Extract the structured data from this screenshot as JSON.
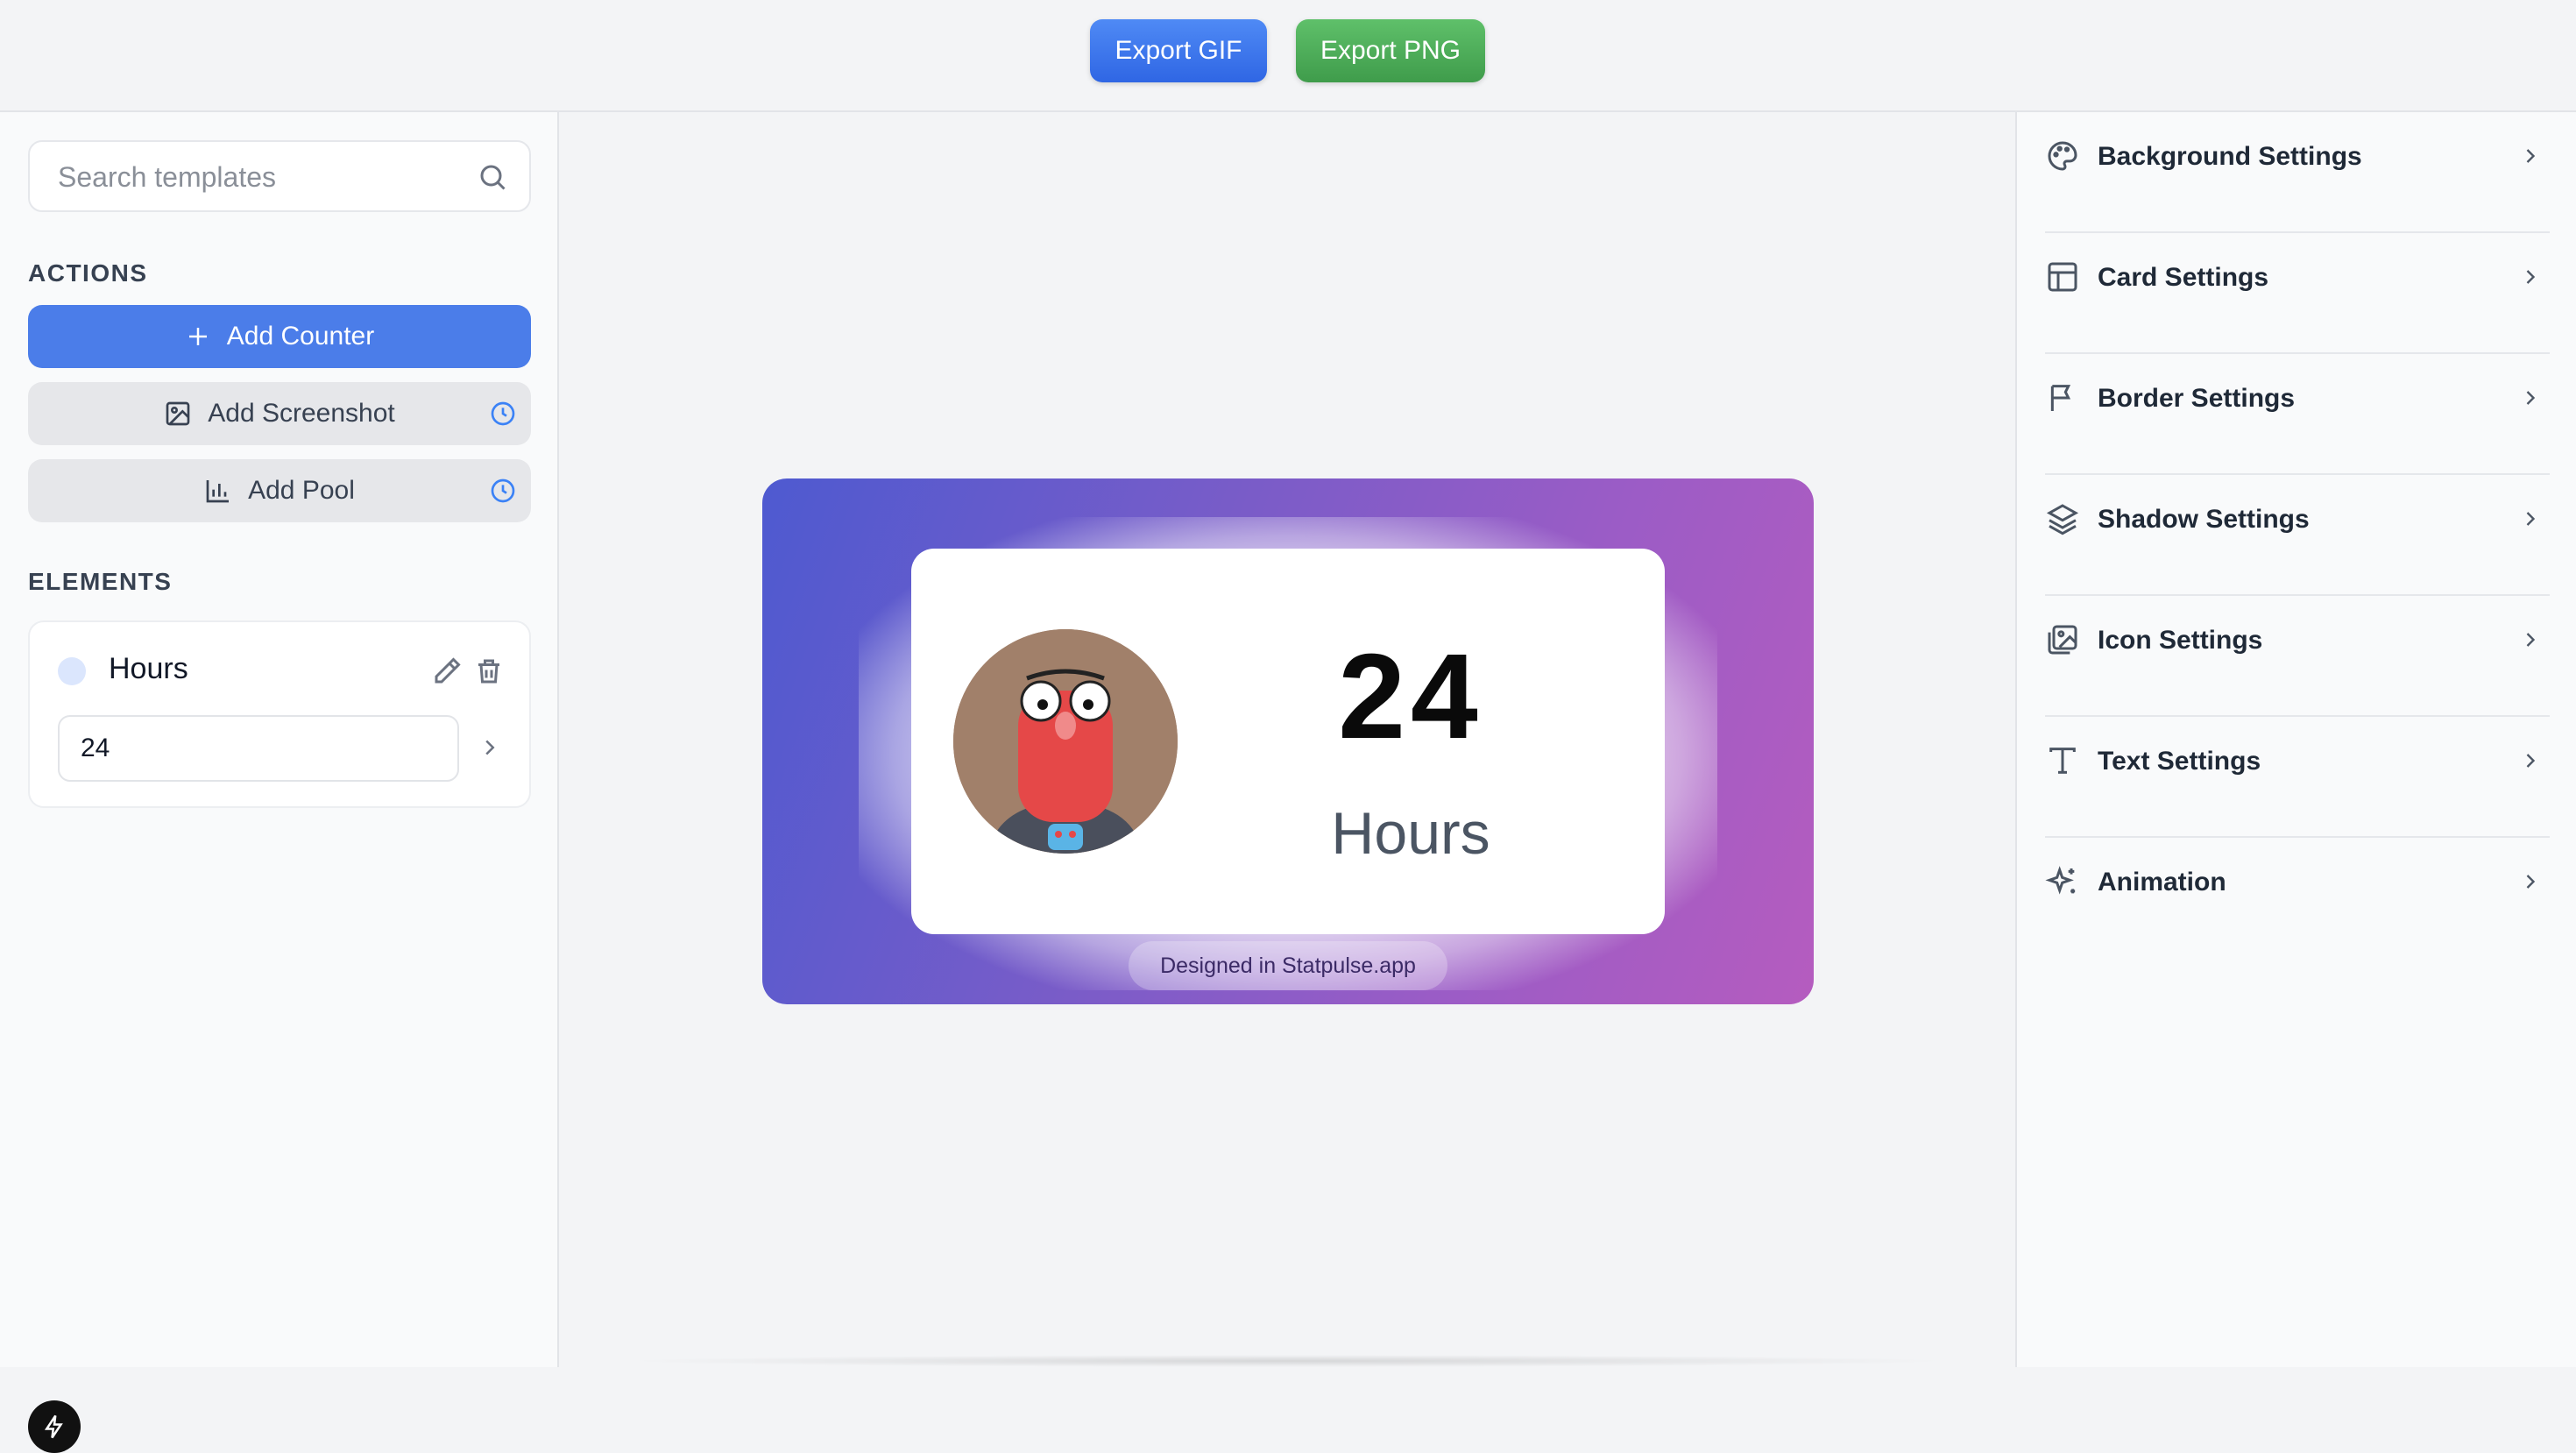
{
  "toolbar": {
    "export_gif": "Export GIF",
    "export_png": "Export PNG"
  },
  "sidebar": {
    "search_placeholder": "Search templates",
    "actions_heading": "ACTIONS",
    "actions": [
      {
        "label": "Add Counter",
        "icon": "plus-icon"
      },
      {
        "label": "Add Screenshot",
        "icon": "image-icon",
        "badge": "clock-icon"
      },
      {
        "label": "Add Pool",
        "icon": "bar-chart-icon",
        "badge": "clock-icon"
      }
    ],
    "elements_heading": "ELEMENTS",
    "elements": [
      {
        "name": "Hours",
        "value": "24"
      }
    ]
  },
  "preview": {
    "count": "24",
    "label": "Hours",
    "footer": "Designed in Statpulse.app"
  },
  "settings": [
    {
      "label": "Background Settings",
      "icon": "palette-icon"
    },
    {
      "label": "Card Settings",
      "icon": "layout-icon"
    },
    {
      "label": "Border Settings",
      "icon": "flag-icon"
    },
    {
      "label": "Shadow Settings",
      "icon": "layers-icon"
    },
    {
      "label": "Icon Settings",
      "icon": "images-icon"
    },
    {
      "label": "Text Settings",
      "icon": "type-icon"
    },
    {
      "label": "Animation",
      "icon": "sparkles-icon"
    }
  ],
  "colors": {
    "primary": "#4b7de9",
    "export_png": "#4caf50",
    "accent_badge": "#3b82f6"
  }
}
